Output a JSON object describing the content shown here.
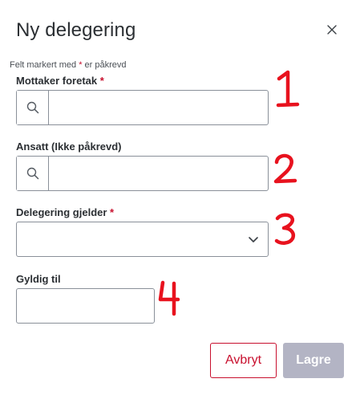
{
  "dialog": {
    "title": "Ny delegering",
    "close_icon": "close-icon",
    "required_note_prefix": "Felt markert med ",
    "required_note_star": "*",
    "required_note_suffix": " er påkrevd"
  },
  "fields": {
    "company": {
      "label": "Mottaker foretak",
      "required_star": "*",
      "value": "",
      "icon": "search-icon"
    },
    "employee": {
      "label": "Ansatt (Ikke påkrevd)",
      "value": "",
      "icon": "search-icon"
    },
    "delegation": {
      "label": "Delegering gjelder",
      "required_star": "*",
      "value": "",
      "icon": "chevron-down-icon"
    },
    "valid_until": {
      "label": "Gyldig til",
      "value": ""
    }
  },
  "buttons": {
    "cancel": "Avbryt",
    "save": "Lagre"
  },
  "annotations": [
    "1",
    "2",
    "3",
    "4"
  ],
  "colors": {
    "required": "#c8102e",
    "cancel_border": "#c8102e",
    "save_disabled_bg": "#b3b4c4",
    "annotation": "#e8121e"
  }
}
